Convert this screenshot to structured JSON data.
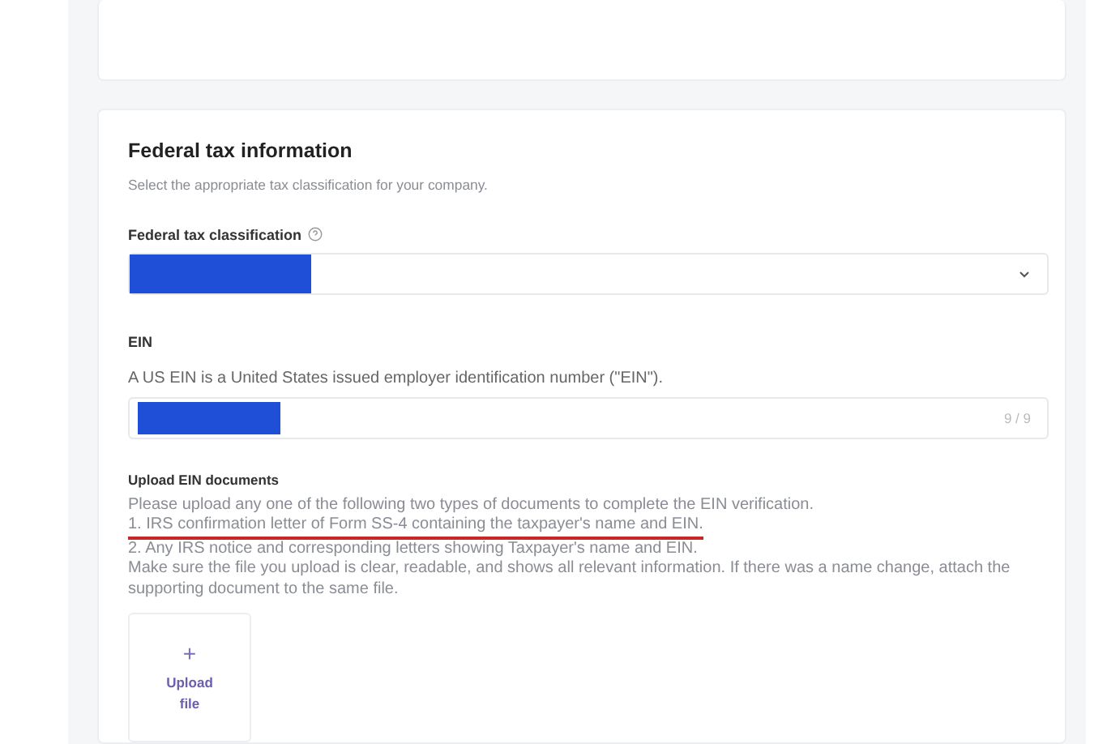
{
  "section": {
    "title": "Federal tax information",
    "subtitle": "Select the appropriate tax classification for your company.",
    "classification": {
      "label": "Federal tax classification",
      "has_help": true,
      "value_redacted": true
    },
    "ein": {
      "label": "EIN",
      "description": "A US EIN is a United States issued employer identification number (\"EIN\").",
      "value_redacted": true,
      "counter": "9 / 9"
    },
    "upload": {
      "title": "Upload EIN documents",
      "lines": [
        {
          "text": "Please upload any one of the following two types of documents to complete the EIN verification.",
          "underlined": false
        },
        {
          "text": "1. IRS confirmation letter of Form SS-4 containing the taxpayer's name and EIN.",
          "underlined": true
        },
        {
          "text": "2. Any IRS notice and corresponding letters showing Taxpayer's name and EIN.",
          "underlined": false
        },
        {
          "text": "Make sure the file you upload is clear, readable, and shows all relevant information. If there was a name change, attach the supporting document to the same file.",
          "underlined": false
        }
      ],
      "button_icon": "+",
      "button_label": "Upload file"
    }
  }
}
